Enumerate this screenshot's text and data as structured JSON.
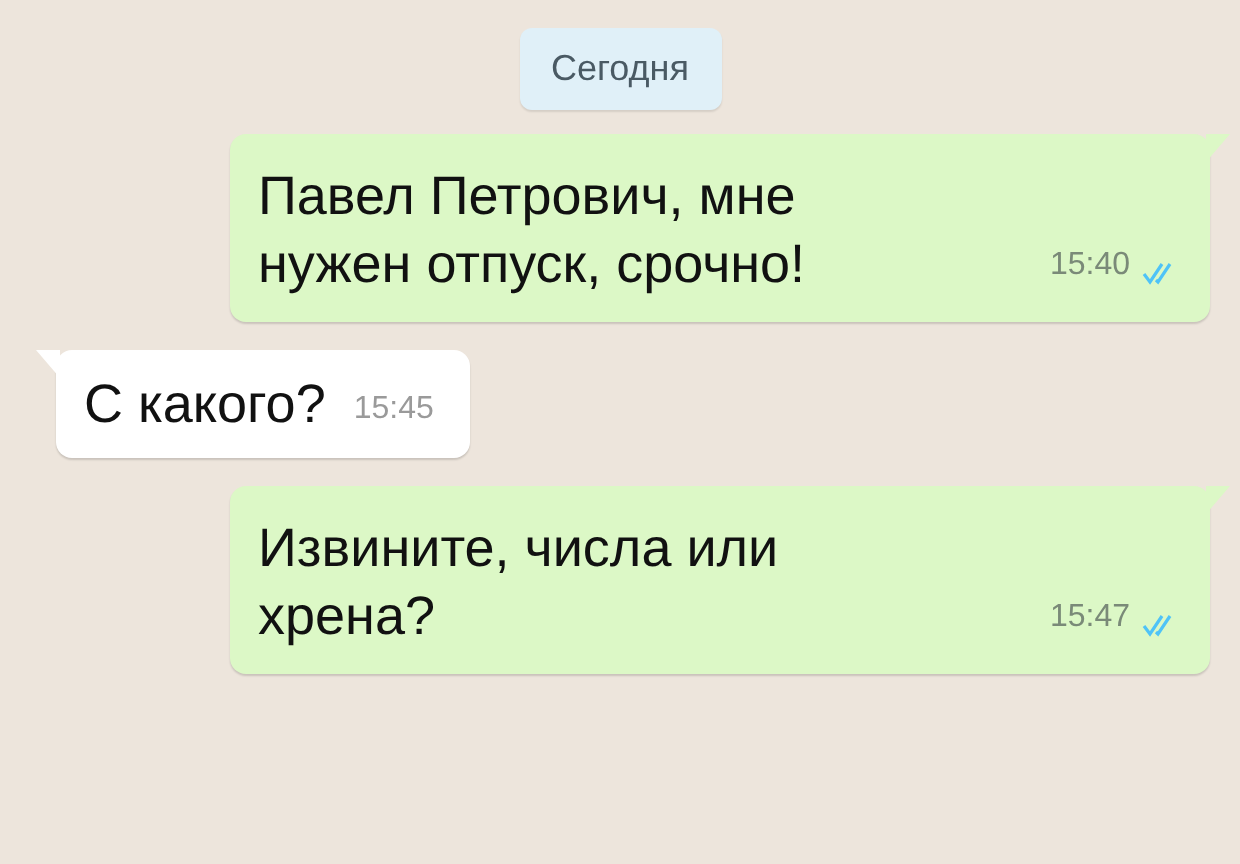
{
  "date_chip": "Сегодня",
  "messages": [
    {
      "kind": "out",
      "text": "Павел Петрович, мне нужен отпуск, срочно!",
      "time": "15:40",
      "read": true
    },
    {
      "kind": "in",
      "text": "С какого?",
      "time": "15:45"
    },
    {
      "kind": "out",
      "text": "Извините, числа или хрена?",
      "time": "15:47",
      "read": true
    }
  ]
}
